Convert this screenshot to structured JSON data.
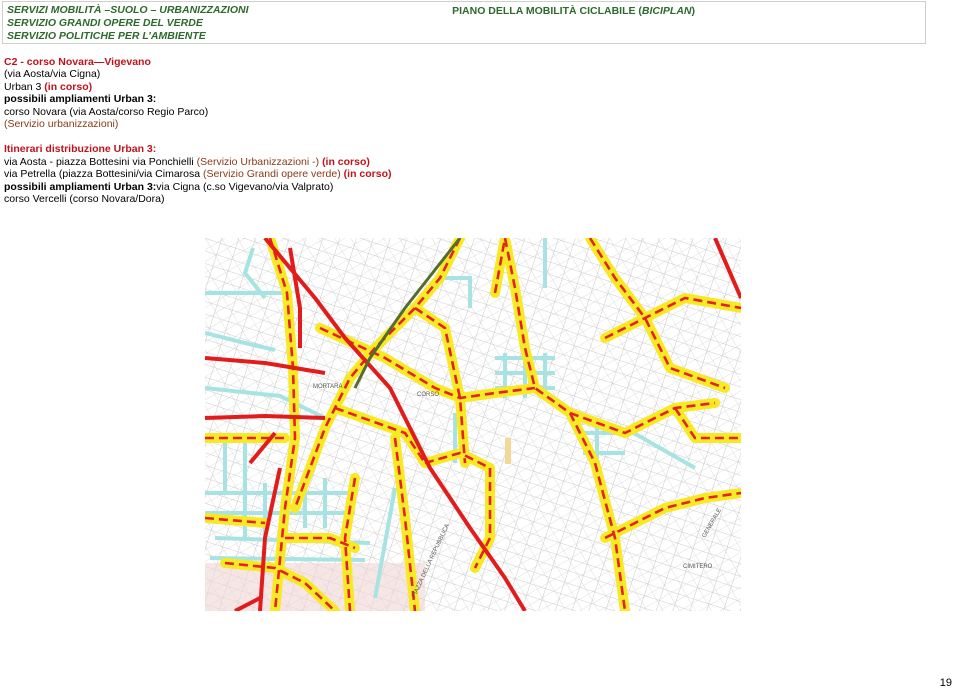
{
  "header": {
    "left_line1": "SERVIZI MOBILITÀ –SUOLO – URBANIZZAZIONI",
    "left_line2": "SERVIZIO GRANDI OPERE DEL VERDE",
    "left_line3": "SERVIZIO POLITICHE PER L’AMBIENTE",
    "right_title": "PIANO DELLA MOBILITÀ CICLABILE (",
    "right_title_italic": "BICIPLAN",
    "right_title_end": ")"
  },
  "section": {
    "code": "C2 - corso Novara—Vigevano",
    "line2": "(via Aosta/via Cigna)",
    "line3_a": "Urban 3 ",
    "line3_b": "(in corso)",
    "line4": "possibili ampliamenti Urban 3:",
    "line5": "corso Novara (via Aosta/corso Regio Parco)",
    "line6": "(Servizio urbanizzazioni)"
  },
  "itinerari": {
    "title": "Itinerari distribuzione Urban 3:",
    "row1_a": "via Aosta - piazza Bottesini via Ponchielli ",
    "row1_b": "(Servizio Urbanizzazioni -) ",
    "row1_c": "(in corso)",
    "row2_a": "via Petrella (piazza Bottesini/via Cimarosa  ",
    "row2_b": "(Servizio Grandi opere verde) ",
    "row2_c": "(in corso)",
    "row3_a": "possibili ampliamenti Urban 3:",
    "row3_b": "via Cigna (c.so Vigevano/via Valprato)",
    "row4": "corso Vercelli (corso Novara/Dora)"
  },
  "map": {
    "labels": [
      "MORTARA",
      "CORSO",
      "CIMITERO",
      "GENERALE",
      "PIAZZA DELLA REPUBBLICA"
    ]
  },
  "page_number": "19"
}
